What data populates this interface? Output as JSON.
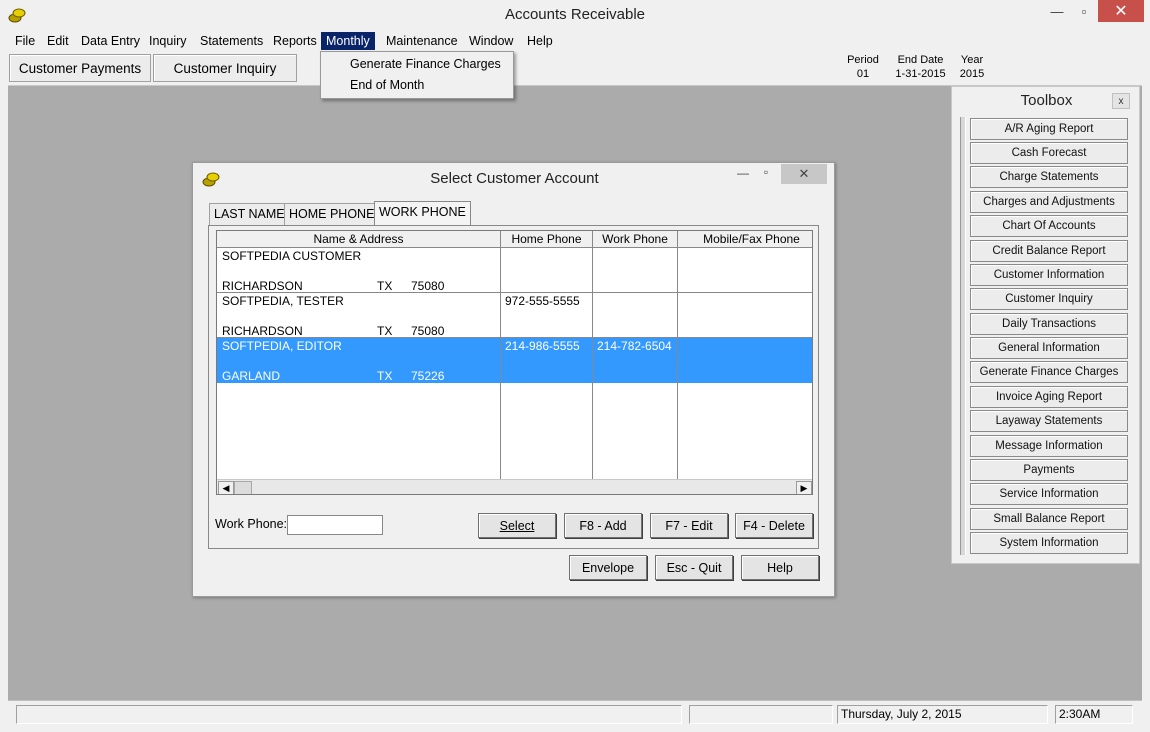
{
  "window": {
    "title": "Accounts Receivable",
    "minimize": "—",
    "maximize": "▫",
    "close": "✕"
  },
  "menu": [
    "File",
    "Edit",
    "Data Entry",
    "Inquiry",
    "Statements",
    "Reports",
    "Monthly",
    "Maintenance",
    "Window",
    "Help"
  ],
  "active_menu": "Monthly",
  "dropdown": [
    "Generate Finance Charges",
    "End of Month"
  ],
  "toolbar": {
    "customer_payments": "Customer Payments",
    "customer_inquiry": "Customer Inquiry"
  },
  "period_info": {
    "period_label": "Period",
    "period_value": "01",
    "end_date_label": "End Date",
    "end_date_value": "1-31-2015",
    "year_label": "Year",
    "year_value": "2015"
  },
  "toolbox": {
    "title": "Toolbox",
    "close": "x",
    "items": [
      "A/R Aging Report",
      "Cash Forecast",
      "Charge Statements",
      "Charges and Adjustments",
      "Chart Of Accounts",
      "Credit Balance Report",
      "Customer Information",
      "Customer Inquiry",
      "Daily Transactions",
      "General Information",
      "Generate Finance Charges",
      "Invoice Aging Report",
      "Layaway Statements",
      "Message Information",
      "Payments",
      "Service Information",
      "Small Balance Report",
      "System Information"
    ]
  },
  "dialog": {
    "title": "Select Customer Account",
    "tabs": [
      "LAST NAME",
      "HOME PHONE",
      "WORK PHONE"
    ],
    "selected_tab": "WORK PHONE",
    "columns": [
      "Name & Address",
      "Home Phone",
      "Work Phone",
      "Mobile/Fax Phone"
    ],
    "rows": [
      {
        "name": "SOFTPEDIA CUSTOMER",
        "city": "RICHARDSON",
        "state": "TX",
        "zip": "75080",
        "home": "",
        "work": "",
        "mobile": "",
        "selected": false
      },
      {
        "name": "SOFTPEDIA,  TESTER",
        "city": "RICHARDSON",
        "state": "TX",
        "zip": "75080",
        "home": "972-555-5555",
        "work": "",
        "mobile": "",
        "selected": false
      },
      {
        "name": "SOFTPEDIA,  EDITOR",
        "city": "GARLAND",
        "state": "TX",
        "zip": "75226",
        "home": "214-986-5555",
        "work": "214-782-6504",
        "mobile": "",
        "selected": true
      }
    ],
    "work_phone_label": "Work Phone:",
    "work_phone_value": "",
    "buttons": {
      "select": "Select",
      "add": "F8 - Add",
      "edit": "F7 - Edit",
      "delete": "F4 - Delete",
      "envelope": "Envelope",
      "quit": "Esc - Quit",
      "help": "Help"
    }
  },
  "status": {
    "date": "Thursday, July  2, 2015",
    "time": "2:30AM"
  },
  "colors": {
    "selection": "#3399ff",
    "menu_active": "#0a246a",
    "mdi_background": "#ababab"
  }
}
